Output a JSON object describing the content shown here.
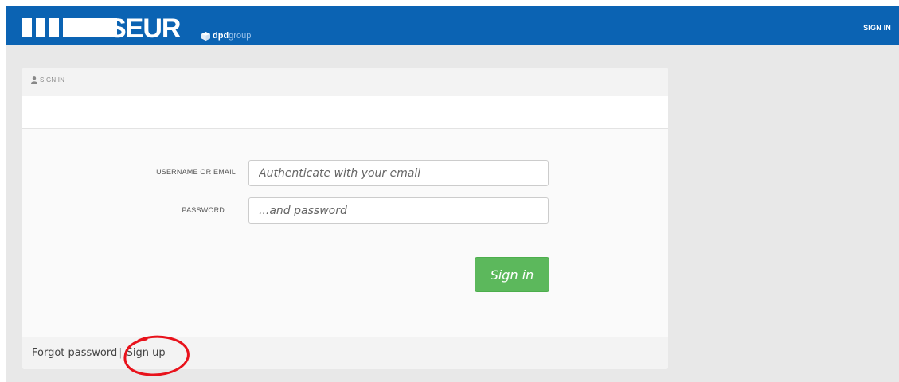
{
  "header": {
    "brand": "SEUR",
    "dpd_brand": "dpd",
    "dpd_suffix": "group",
    "signin_link": "SIGN IN",
    "bar_color": "#0b63b3"
  },
  "panel": {
    "heading_icon": "user-icon",
    "heading": "SIGN IN",
    "fields": {
      "username_label": "USERNAME OR EMAIL",
      "username_placeholder": "Authenticate with your email",
      "username_value": "",
      "password_label": "PASSWORD",
      "password_placeholder": "...and password",
      "password_value": ""
    },
    "submit_label": "Sign in",
    "submit_color": "#5cb85c",
    "footer": {
      "forgot_label": "Forgot password",
      "separator": "|",
      "signup_label": "Sign up"
    }
  },
  "annotation": {
    "color": "#e8121b"
  }
}
